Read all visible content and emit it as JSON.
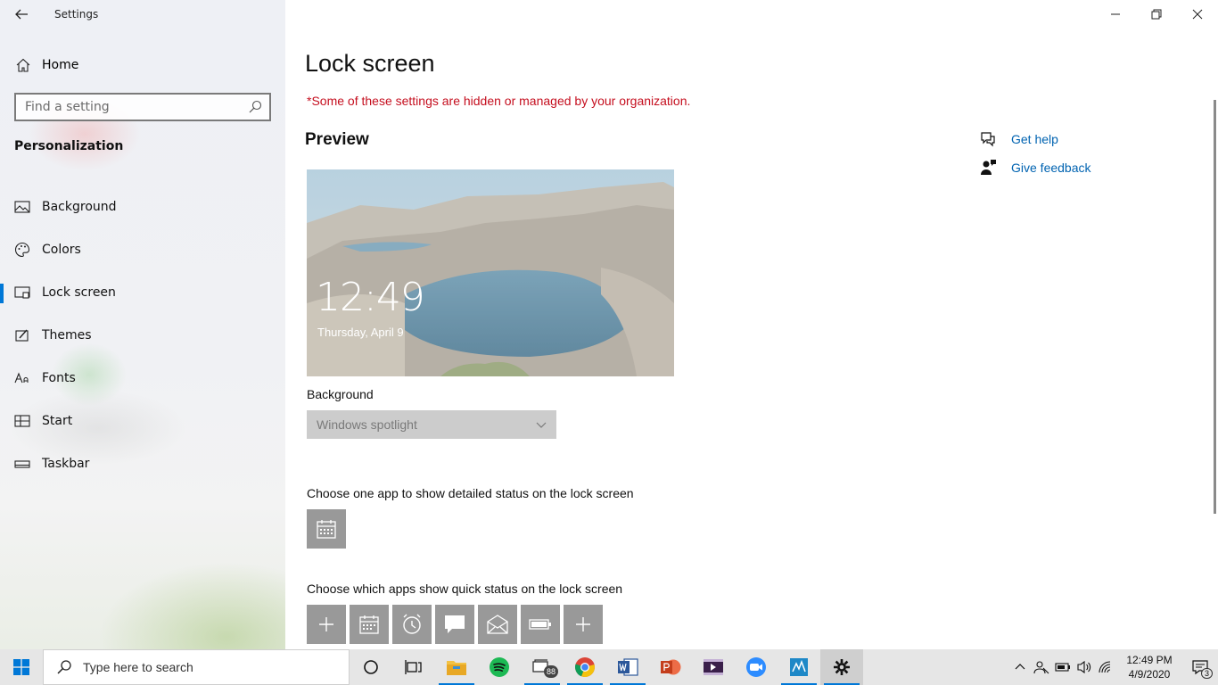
{
  "window": {
    "app_title": "Settings"
  },
  "sidebar": {
    "home_label": "Home",
    "search_placeholder": "Find a setting",
    "section_title": "Personalization",
    "items": [
      {
        "label": "Background",
        "icon": "picture-icon"
      },
      {
        "label": "Colors",
        "icon": "palette-icon"
      },
      {
        "label": "Lock screen",
        "icon": "lock-screen-icon",
        "active": true
      },
      {
        "label": "Themes",
        "icon": "brush-icon"
      },
      {
        "label": "Fonts",
        "icon": "font-icon"
      },
      {
        "label": "Start",
        "icon": "start-layout-icon"
      },
      {
        "label": "Taskbar",
        "icon": "taskbar-icon"
      }
    ]
  },
  "main": {
    "title": "Lock screen",
    "org_notice": "*Some of these settings are hidden or managed by your organization.",
    "preview_heading": "Preview",
    "preview": {
      "time": "12:49",
      "date": "Thursday, April 9"
    },
    "background_label": "Background",
    "background_value": "Windows spotlight",
    "detailed_status_label": "Choose one app to show detailed status on the lock screen",
    "quick_status_label": "Choose which apps show quick status on the lock screen",
    "quick_apps": [
      "add-icon",
      "calendar-icon",
      "alarm-clock-icon",
      "message-icon",
      "mail-icon",
      "battery-icon",
      "add-icon"
    ]
  },
  "related": {
    "get_help": "Get help",
    "give_feedback": "Give feedback"
  },
  "taskbar": {
    "search_placeholder": "Type here to search",
    "apps": [
      "cortana-icon",
      "task-view-icon",
      "file-explorer-icon",
      "spotify-icon",
      "app-badge-icon",
      "chrome-icon",
      "word-icon",
      "powerpoint-icon",
      "video-editor-icon",
      "zoom-icon",
      "app-icon",
      "settings-icon"
    ],
    "badge_count": "88",
    "clock_time": "12:49 PM",
    "clock_date": "4/9/2020",
    "notification_count": "3"
  },
  "colors": {
    "accent": "#0078d7",
    "link": "#0063b1",
    "warning": "#c50f1f"
  }
}
